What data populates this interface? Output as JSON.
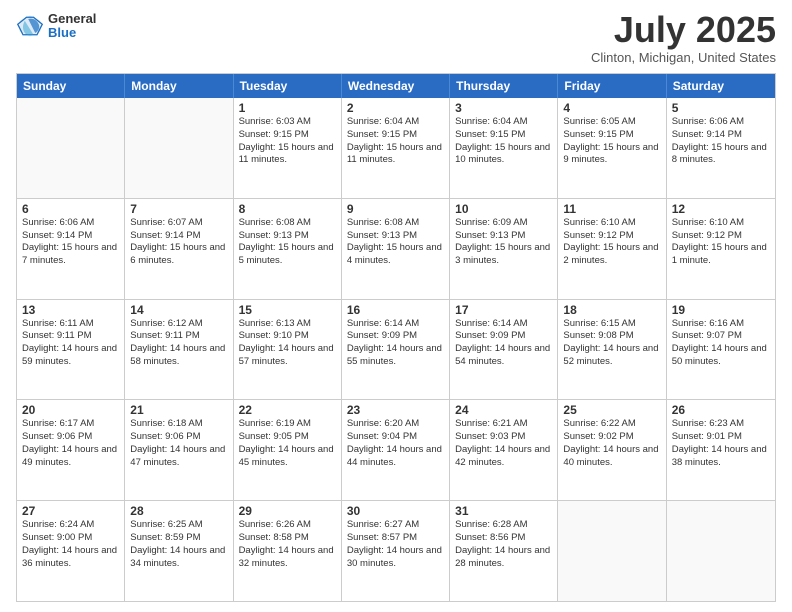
{
  "header": {
    "logo_general": "General",
    "logo_blue": "Blue",
    "title": "July 2025",
    "location": "Clinton, Michigan, United States"
  },
  "calendar": {
    "days_of_week": [
      "Sunday",
      "Monday",
      "Tuesday",
      "Wednesday",
      "Thursday",
      "Friday",
      "Saturday"
    ],
    "weeks": [
      [
        {
          "day": "",
          "sunrise": "",
          "sunset": "",
          "daylight": "",
          "empty": true
        },
        {
          "day": "",
          "sunrise": "",
          "sunset": "",
          "daylight": "",
          "empty": true
        },
        {
          "day": "1",
          "sunrise": "Sunrise: 6:03 AM",
          "sunset": "Sunset: 9:15 PM",
          "daylight": "Daylight: 15 hours and 11 minutes."
        },
        {
          "day": "2",
          "sunrise": "Sunrise: 6:04 AM",
          "sunset": "Sunset: 9:15 PM",
          "daylight": "Daylight: 15 hours and 11 minutes."
        },
        {
          "day": "3",
          "sunrise": "Sunrise: 6:04 AM",
          "sunset": "Sunset: 9:15 PM",
          "daylight": "Daylight: 15 hours and 10 minutes."
        },
        {
          "day": "4",
          "sunrise": "Sunrise: 6:05 AM",
          "sunset": "Sunset: 9:15 PM",
          "daylight": "Daylight: 15 hours and 9 minutes."
        },
        {
          "day": "5",
          "sunrise": "Sunrise: 6:06 AM",
          "sunset": "Sunset: 9:14 PM",
          "daylight": "Daylight: 15 hours and 8 minutes."
        }
      ],
      [
        {
          "day": "6",
          "sunrise": "Sunrise: 6:06 AM",
          "sunset": "Sunset: 9:14 PM",
          "daylight": "Daylight: 15 hours and 7 minutes."
        },
        {
          "day": "7",
          "sunrise": "Sunrise: 6:07 AM",
          "sunset": "Sunset: 9:14 PM",
          "daylight": "Daylight: 15 hours and 6 minutes."
        },
        {
          "day": "8",
          "sunrise": "Sunrise: 6:08 AM",
          "sunset": "Sunset: 9:13 PM",
          "daylight": "Daylight: 15 hours and 5 minutes."
        },
        {
          "day": "9",
          "sunrise": "Sunrise: 6:08 AM",
          "sunset": "Sunset: 9:13 PM",
          "daylight": "Daylight: 15 hours and 4 minutes."
        },
        {
          "day": "10",
          "sunrise": "Sunrise: 6:09 AM",
          "sunset": "Sunset: 9:13 PM",
          "daylight": "Daylight: 15 hours and 3 minutes."
        },
        {
          "day": "11",
          "sunrise": "Sunrise: 6:10 AM",
          "sunset": "Sunset: 9:12 PM",
          "daylight": "Daylight: 15 hours and 2 minutes."
        },
        {
          "day": "12",
          "sunrise": "Sunrise: 6:10 AM",
          "sunset": "Sunset: 9:12 PM",
          "daylight": "Daylight: 15 hours and 1 minute."
        }
      ],
      [
        {
          "day": "13",
          "sunrise": "Sunrise: 6:11 AM",
          "sunset": "Sunset: 9:11 PM",
          "daylight": "Daylight: 14 hours and 59 minutes."
        },
        {
          "day": "14",
          "sunrise": "Sunrise: 6:12 AM",
          "sunset": "Sunset: 9:11 PM",
          "daylight": "Daylight: 14 hours and 58 minutes."
        },
        {
          "day": "15",
          "sunrise": "Sunrise: 6:13 AM",
          "sunset": "Sunset: 9:10 PM",
          "daylight": "Daylight: 14 hours and 57 minutes."
        },
        {
          "day": "16",
          "sunrise": "Sunrise: 6:14 AM",
          "sunset": "Sunset: 9:09 PM",
          "daylight": "Daylight: 14 hours and 55 minutes."
        },
        {
          "day": "17",
          "sunrise": "Sunrise: 6:14 AM",
          "sunset": "Sunset: 9:09 PM",
          "daylight": "Daylight: 14 hours and 54 minutes."
        },
        {
          "day": "18",
          "sunrise": "Sunrise: 6:15 AM",
          "sunset": "Sunset: 9:08 PM",
          "daylight": "Daylight: 14 hours and 52 minutes."
        },
        {
          "day": "19",
          "sunrise": "Sunrise: 6:16 AM",
          "sunset": "Sunset: 9:07 PM",
          "daylight": "Daylight: 14 hours and 50 minutes."
        }
      ],
      [
        {
          "day": "20",
          "sunrise": "Sunrise: 6:17 AM",
          "sunset": "Sunset: 9:06 PM",
          "daylight": "Daylight: 14 hours and 49 minutes."
        },
        {
          "day": "21",
          "sunrise": "Sunrise: 6:18 AM",
          "sunset": "Sunset: 9:06 PM",
          "daylight": "Daylight: 14 hours and 47 minutes."
        },
        {
          "day": "22",
          "sunrise": "Sunrise: 6:19 AM",
          "sunset": "Sunset: 9:05 PM",
          "daylight": "Daylight: 14 hours and 45 minutes."
        },
        {
          "day": "23",
          "sunrise": "Sunrise: 6:20 AM",
          "sunset": "Sunset: 9:04 PM",
          "daylight": "Daylight: 14 hours and 44 minutes."
        },
        {
          "day": "24",
          "sunrise": "Sunrise: 6:21 AM",
          "sunset": "Sunset: 9:03 PM",
          "daylight": "Daylight: 14 hours and 42 minutes."
        },
        {
          "day": "25",
          "sunrise": "Sunrise: 6:22 AM",
          "sunset": "Sunset: 9:02 PM",
          "daylight": "Daylight: 14 hours and 40 minutes."
        },
        {
          "day": "26",
          "sunrise": "Sunrise: 6:23 AM",
          "sunset": "Sunset: 9:01 PM",
          "daylight": "Daylight: 14 hours and 38 minutes."
        }
      ],
      [
        {
          "day": "27",
          "sunrise": "Sunrise: 6:24 AM",
          "sunset": "Sunset: 9:00 PM",
          "daylight": "Daylight: 14 hours and 36 minutes."
        },
        {
          "day": "28",
          "sunrise": "Sunrise: 6:25 AM",
          "sunset": "Sunset: 8:59 PM",
          "daylight": "Daylight: 14 hours and 34 minutes."
        },
        {
          "day": "29",
          "sunrise": "Sunrise: 6:26 AM",
          "sunset": "Sunset: 8:58 PM",
          "daylight": "Daylight: 14 hours and 32 minutes."
        },
        {
          "day": "30",
          "sunrise": "Sunrise: 6:27 AM",
          "sunset": "Sunset: 8:57 PM",
          "daylight": "Daylight: 14 hours and 30 minutes."
        },
        {
          "day": "31",
          "sunrise": "Sunrise: 6:28 AM",
          "sunset": "Sunset: 8:56 PM",
          "daylight": "Daylight: 14 hours and 28 minutes."
        },
        {
          "day": "",
          "sunrise": "",
          "sunset": "",
          "daylight": "",
          "empty": true
        },
        {
          "day": "",
          "sunrise": "",
          "sunset": "",
          "daylight": "",
          "empty": true
        }
      ]
    ]
  }
}
